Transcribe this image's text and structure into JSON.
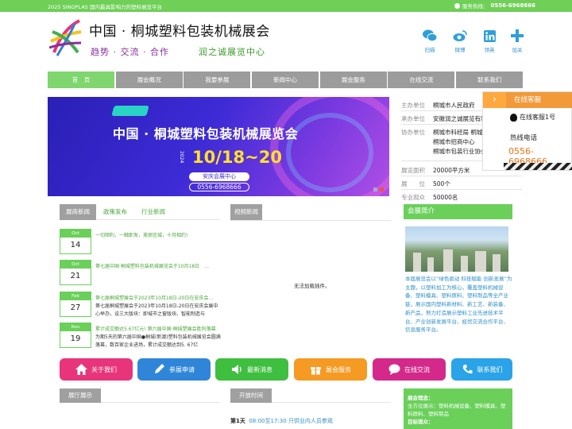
{
  "topbar": {
    "left_text": "2025 SINOPLAS 国内最具影响力的塑料展览平台",
    "phone_label": "服务热线：",
    "phone": "0556-6968666"
  },
  "header": {
    "title": "中国 · 桐城塑料包装机械展会",
    "slogan": "趋势 · 交流 · 合作",
    "slogan2": "润之诚展览中心",
    "share": [
      {
        "icon": "wechat-icon",
        "label": "扫描"
      },
      {
        "icon": "weibo-icon",
        "label": "微博"
      },
      {
        "icon": "linkedin-icon",
        "label": "领英"
      },
      {
        "icon": "plus-icon",
        "label": "加关"
      }
    ]
  },
  "nav": [
    {
      "label": "首　页",
      "active": true
    },
    {
      "label": "展会概况"
    },
    {
      "label": "我要参展"
    },
    {
      "label": "新闻中心"
    },
    {
      "label": "展会服务"
    },
    {
      "label": "在线交流"
    },
    {
      "label": "联系我们"
    }
  ],
  "banner": {
    "title": "中国 · 桐城塑料包装机械展览会",
    "year": "2024",
    "date": "10/18~20",
    "venue": "安庆会展中心",
    "phone": "0556-6968666"
  },
  "info": [
    {
      "k": "主办单位",
      "v": "桐城市人民政府"
    },
    {
      "k": "承办单位",
      "v": "安徽润之诚展览有限公司"
    },
    {
      "k": "协办单位",
      "v": "桐城市科经局 桐城市商务局"
    },
    {
      "k": "",
      "v": "桐城市招商中心"
    },
    {
      "k": "",
      "v": "桐城市包装行业协会 新渡镇"
    },
    {
      "k": "展览面积",
      "v": "20000平方米"
    },
    {
      "k": "展　　位",
      "v": "500个"
    },
    {
      "k": "专业观众",
      "v": "50000名"
    }
  ],
  "service": {
    "title": "在线客服",
    "qq": "在线客服1号",
    "hotline_label": "热线电话",
    "hotline": "0556-6968666"
  },
  "news_tabs": [
    "展商新闻",
    "政策发布",
    "行业新闻"
  ],
  "news": [
    {
      "month": "Oct",
      "day": "14",
      "title": "一切顺利，一触即发，美丽宜城，十月相约!",
      "desc": ""
    },
    {
      "month": "Oct",
      "day": "21",
      "title": "第七届中国·桐城塑料包装机械展览会于10月18日　…",
      "desc": ""
    },
    {
      "month": "Feb",
      "day": "27",
      "title": "第七届桐城塑展会于2023年10月18日-20日在安庆会…",
      "desc": "第七届桐城塑展会于2023年10月18日-20日在安庆会展中心举办，设三大版块：即城市之窗版块、智能制造与"
    },
    {
      "month": "Nov",
      "day": "19",
      "title": "累计成交额达5.67亿元! 第六届中国·桐城塑展会胜利落幕",
      "desc": "为期5天的第六届中国●桐城(新渡)塑料包装机械展览会圆满落幕，数百家企业进场，累计成交额达到5. 67亿"
    }
  ],
  "video": {
    "title": "视频新闻",
    "message": "无法加载插件。"
  },
  "about": {
    "title": "会展简介",
    "text": "本届展览会以“绿色驱动 科技赋能 创新发展”为主题，以塑料加工为核心，覆盖塑料机械设备、塑料模具、塑料原料、塑料制品等全产业链，展示国内塑料新材料、新工艺、新装备、新产品，努力打造展示塑料工业先进技术平台、产业创新发展平台、经贸交流合作平台、信息服务平台。"
  },
  "buttons": [
    {
      "label": "关于我们",
      "icon": "home-icon",
      "color": "#e8347a"
    },
    {
      "label": "参展申请",
      "icon": "pencil-icon",
      "color": "#2f86d9"
    },
    {
      "label": "最新消息",
      "icon": "speaker-icon",
      "color": "#3fbf3f"
    },
    {
      "label": "展会服务",
      "icon": "gift-icon",
      "color": "#f59a23"
    },
    {
      "label": "在线交流",
      "icon": "chat-icon",
      "color": "#d4298a"
    },
    {
      "label": "联系我们",
      "icon": "phone-icon",
      "color": "#2aa3e8"
    }
  ],
  "bottom": {
    "hall_title": "展厅展示",
    "time_title": "开放时间",
    "schedule_day": "第1天",
    "schedule_text": "08:00至17:30 只供业内人员参观",
    "concept_label": "展会理念：",
    "concept_text": "全方位展示：塑料机械设备、塑料模具、塑料原料、塑料制品",
    "concept_more": "目标观众："
  }
}
